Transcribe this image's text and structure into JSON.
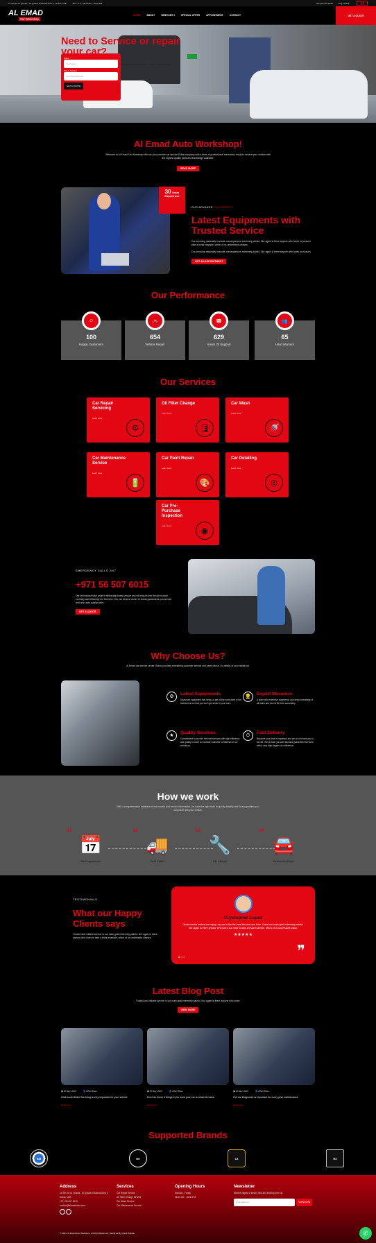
{
  "topbar": {
    "address": "14 Sth St 46, Qusais - Al Qusais Industrial Area 4 - Dubai, UAE",
    "hours": "Mon - Fri : 08.30 AM - 18.30 PM",
    "phone": "+971 56 507 6015",
    "language": "Eng | Arabic"
  },
  "nav": {
    "logo_main": "AL EMAD",
    "logo_sub": "Car Workshop",
    "items": [
      "HOME",
      "ABOUT",
      "SERVICES ▾",
      "SPECIAL OFFER",
      "APPOINTMENT",
      "CONTACT"
    ],
    "quote_button": "GET A QUOTE"
  },
  "hero": {
    "title": "Need to Service or repair your car?",
    "text": "Al Emad aims to provide an excellent car service experience and help keep your vehicle in great shape.",
    "form": {
      "name_label": "Name",
      "name_placeholder": "Your Name",
      "phone_label": "Phone Number",
      "phone_placeholder": "Your Phone Number",
      "submit": "GET A QUOTE"
    }
  },
  "intro": {
    "title": "Al Emad Auto Workshop!",
    "text": "Welcome to Al Emad Car Workshop! We are your premier car service Dubai company with a team of professional mechanics ready to service your vehicle with the highest quality parts and knowledge available.",
    "button": "READ MORE"
  },
  "about": {
    "exp_number": "30",
    "exp_word": "Years",
    "exp_label": "Experience",
    "kicker_prefix": "OUR ADVANCE",
    "kicker_accent": "EQUIPMENTS",
    "title": "Latest Equipments with Trusted Service",
    "p1": "Car servicing nationally innovate consequences extremely painful. Nor again is there anyone who loves or pursues take a trivial example, which of us undertakes classes.",
    "p2": "Car servicing nationally innovate consequences extremely painful. Nor again is there anyone who loves or pursues",
    "button": "GET AN APPOINTMENT"
  },
  "performance": {
    "title": "Our Performance",
    "items": [
      {
        "icon": "smile-icon",
        "glyph": "☺",
        "value": "100",
        "label": "Happy Customers"
      },
      {
        "icon": "car-icon",
        "glyph": "🚗",
        "value": "654",
        "label": "Vehicle Repair"
      },
      {
        "icon": "headset-icon",
        "glyph": "☎",
        "value": "629",
        "label": "Hours Of Support"
      },
      {
        "icon": "workers-icon",
        "glyph": "👥",
        "value": "65",
        "label": "Hard Workers"
      }
    ]
  },
  "services": {
    "title": "Our Services",
    "learn_more": "Learn more",
    "items": [
      {
        "title": "Car Repair Servicing",
        "glyph": "⚙"
      },
      {
        "title": "Oil Filter Change",
        "glyph": "🛢"
      },
      {
        "title": "Car Wash",
        "glyph": "🚿"
      },
      {
        "title": "Car Maintenance Service",
        "glyph": "🔋"
      },
      {
        "title": "Car Paint Repair",
        "glyph": "🎨"
      },
      {
        "title": "Car Detailing",
        "glyph": "◎"
      },
      {
        "title": "Car Pre-Purchase Inspection",
        "glyph": "◉"
      }
    ]
  },
  "emergency": {
    "kicker": "EMERGENCY CALLS 24/7",
    "phone": "+971 56 507 6015",
    "text": "Our technicians take pride in delivering timely service and will ensure that the job is done correctly and efficiently the first time. Our car service center in Dubai guarantees you service and only uses quality parts.",
    "button": "GET A QUOTE"
  },
  "why": {
    "title": "Why Choose Us?",
    "text": "Al Emad car service center Dubai, provides everything customer service and cares about. Do details of your repair job.",
    "features": [
      {
        "icon": "gear-icon",
        "glyph": "⚙",
        "title": "Latest Equipments",
        "text": "Advanced equipment that helps us get all the work done in the fastest time so that you don't get stuck in your work."
      },
      {
        "icon": "mechanic-icon",
        "glyph": "👷",
        "title": "Expert Mecanics",
        "text": "A team with extensive experience and deep knowledge of all faults and how to fix them accurately."
      },
      {
        "icon": "quality-icon",
        "glyph": "★",
        "title": "Quality Services",
        "text": "Commitment to provide the best services with high efficiency and quality in order to increase customer confidence in our workshop."
      },
      {
        "icon": "clock-icon",
        "glyph": "⏱",
        "title": "Fast Delivery",
        "text": "Because your time is important and we do not want you to be idle. We provide you with fast and guaranteed services with a very high degree of confidence."
      }
    ]
  },
  "how": {
    "title": "How we work",
    "text": "With a comprehensive database of car models and service information, we have the right tools to quickly identify and fix any problem you may have with your vehicle.",
    "steps": [
      {
        "num": "01",
        "icon": "calendar-icon",
        "glyph": "📅",
        "label": "Book appointment"
      },
      {
        "num": "02",
        "icon": "tow-truck-icon",
        "glyph": "🚚",
        "label": "Get it Picked"
      },
      {
        "num": "03",
        "icon": "repair-icon",
        "glyph": "🔧",
        "label": "Get it Repair"
      },
      {
        "num": "04",
        "icon": "delivery-icon",
        "glyph": "🚘",
        "label": "Delivered to Home"
      }
    ]
  },
  "testimonials": {
    "kicker": "TESTIMONIALS",
    "title": "What our Happy Clients says",
    "text": "Trusted and reliable service is our main goal extremely painful. Nor again is there anyone who loves to take a trivial example, which of us undertakes classes.",
    "name": "Cryctopher Lopez",
    "quote": "Great service makes me happy, my car is like the most the new one here. Great our main goal extremely painful. Nor again is there anyone who loves our main to take a trivial example, which of us undertakes value.",
    "stars": "★★★★★"
  },
  "blog": {
    "title": "Latest Blog Post",
    "text": "Trusted and reliable service is our main goal extremely painful. Nor again is there anyone who loves.",
    "button": "VIEW MORE",
    "read_more": "Read more",
    "posts": [
      {
        "date": "26 May, 2023",
        "author": "Albert Ross",
        "title": "Grab book Brake Servicing is very important for your vehicle"
      },
      {
        "date": "26 May, 2023",
        "author": "Albert Ross",
        "title": "Don't do these 4 things if you want your car to retain its value"
      },
      {
        "date": "26 May, 2023",
        "author": "Albert Ross",
        "title": "Full car Diagnostic is important for every year maintenance"
      }
    ]
  },
  "brands": {
    "title": "Supported Brands",
    "items": [
      "BMW",
      "Mercedes-Benz",
      "Lamborghini",
      "Rolls-Royce"
    ]
  },
  "footer": {
    "address_title": "Address",
    "address": "14 Sth St 46, Qusais - Al Qusais Industrial Area 4 Dubai, UAE",
    "phone": "+971 56 507 6015",
    "email": "contact@alemadcars.com",
    "services_title": "Services",
    "services": [
      "Car Repair Service",
      "Oil Filter Change Service",
      "Car Wash Service",
      "Car Maintenance Service"
    ],
    "hours_title": "Opening Hours",
    "hours_days": "Monday - Friday",
    "hours_time": "08.30 AM - 18.30 PM",
    "newsletter_title": "Newsletter",
    "newsletter_text": "Monthly digest of what's new and exciting from us.",
    "email_placeholder": "Email address",
    "subscribe": "SUBSCRIBE",
    "copyright": "© 2023, Al Emad Auto Workshop, All Right Reserved, Designed By Quick Digitals"
  },
  "colors": {
    "accent": "#e30613",
    "background": "#000000",
    "panel": "#555555"
  }
}
